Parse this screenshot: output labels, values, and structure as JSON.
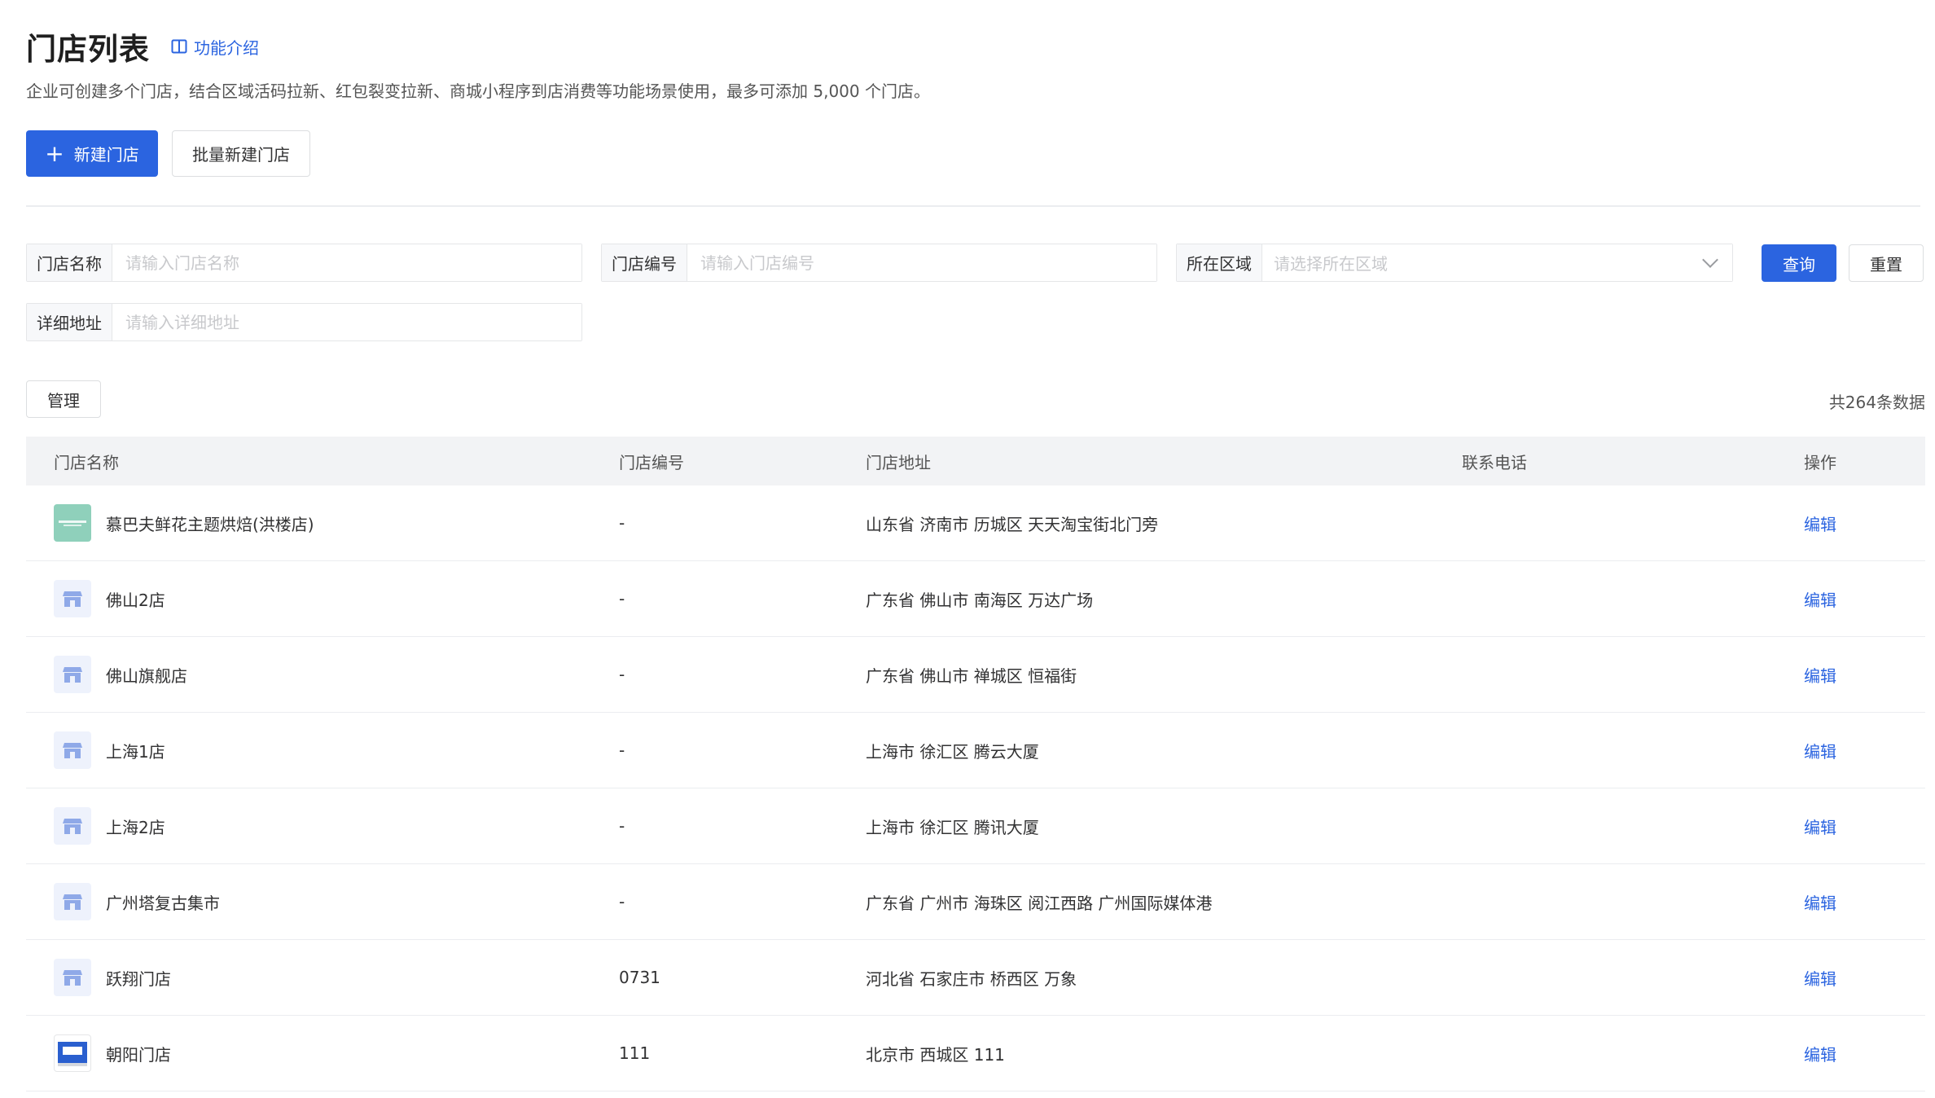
{
  "header": {
    "title": "门店列表",
    "intro_link": "功能介绍",
    "description": "企业可创建多个门店，结合区域活码拉新、红包裂变拉新、商城小程序到店消费等功能场景使用，最多可添加 5,000 个门店。"
  },
  "actions": {
    "new_store": "新建门店",
    "batch_new_store": "批量新建门店"
  },
  "filters": {
    "store_name": {
      "label": "门店名称",
      "placeholder": "请输入门店名称"
    },
    "store_code": {
      "label": "门店编号",
      "placeholder": "请输入门店编号"
    },
    "region": {
      "label": "所在区域",
      "placeholder": "请选择所在区域"
    },
    "address": {
      "label": "详细地址",
      "placeholder": "请输入详细地址"
    },
    "query": "查询",
    "reset": "重置"
  },
  "list": {
    "manage": "管理",
    "total": "共264条数据",
    "columns": [
      "门店名称",
      "门店编号",
      "门店地址",
      "联系电话",
      "操作"
    ],
    "edit_label": "编辑",
    "rows": [
      {
        "name": "慕巴夫鲜花主题烘焙(洪楼店)",
        "code": "-",
        "address": "山东省 济南市 历城区 天天淘宝街北门旁",
        "phone": "",
        "thumb": "logo"
      },
      {
        "name": "佛山2店",
        "code": "-",
        "address": "广东省 佛山市 南海区 万达广场",
        "phone": "",
        "thumb": "store"
      },
      {
        "name": "佛山旗舰店",
        "code": "-",
        "address": "广东省 佛山市 禅城区 恒福街",
        "phone": "",
        "thumb": "store"
      },
      {
        "name": "上海1店",
        "code": "-",
        "address": "上海市 徐汇区 腾云大厦",
        "phone": "",
        "thumb": "store"
      },
      {
        "name": "上海2店",
        "code": "-",
        "address": "上海市 徐汇区 腾讯大厦",
        "phone": "",
        "thumb": "store"
      },
      {
        "name": "广州塔复古集市",
        "code": "-",
        "address": "广东省 广州市 海珠区 阅江西路 广州国际媒体港",
        "phone": "",
        "thumb": "store"
      },
      {
        "name": "跃翔门店",
        "code": "0731",
        "address": "河北省 石家庄市 桥西区 万象",
        "phone": "",
        "thumb": "store"
      },
      {
        "name": "朝阳门店",
        "code": "111",
        "address": "北京市 西城区 111",
        "phone": "",
        "thumb": "photo"
      }
    ]
  },
  "colors": {
    "accent": "#2b64e0",
    "header_bg": "#f2f3f5"
  }
}
